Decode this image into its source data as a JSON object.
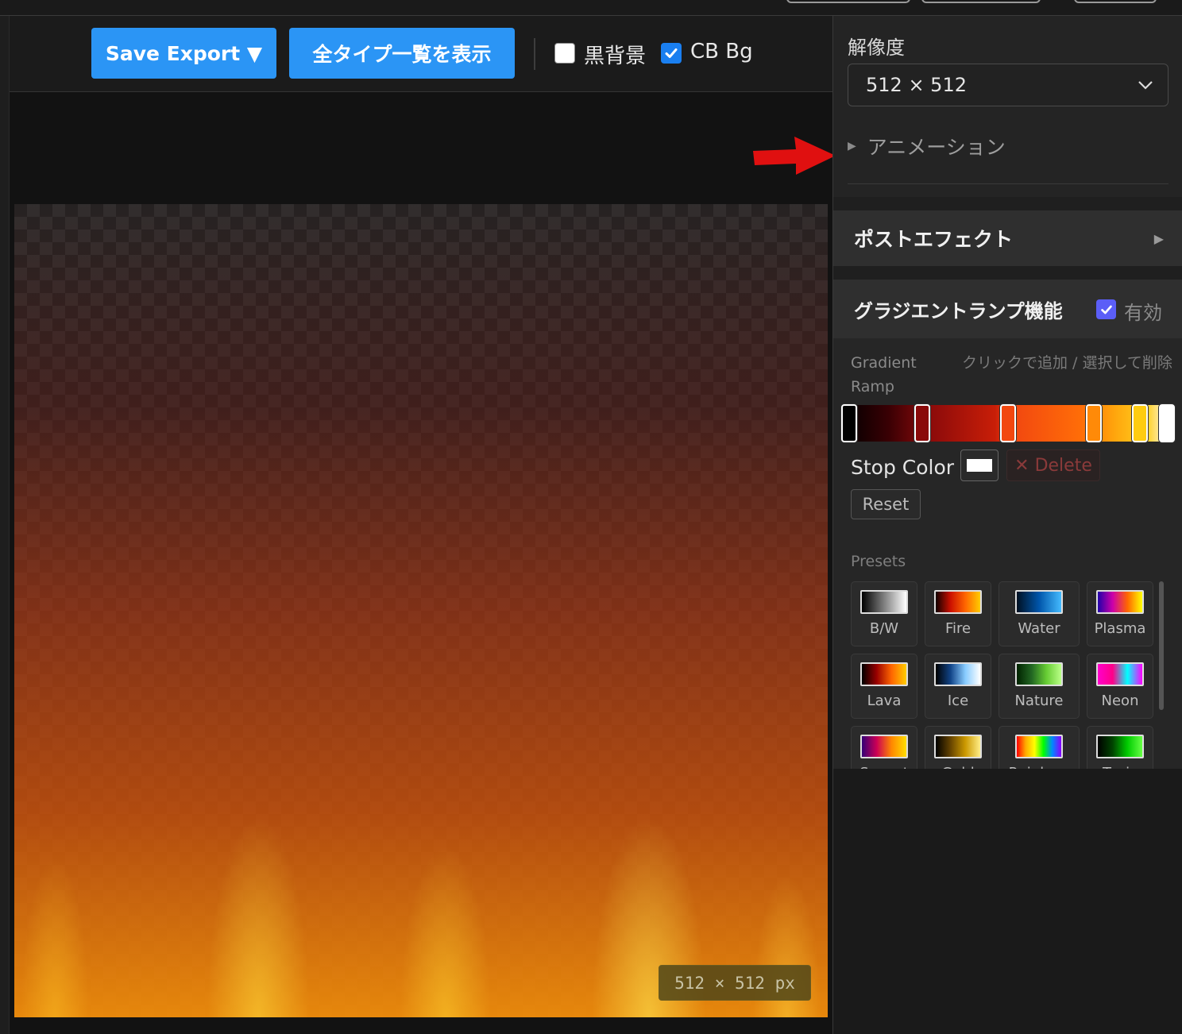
{
  "toolbar": {
    "save_export_label": "Save Export ▼",
    "show_all_types_label": "全タイプ一覧を表示",
    "black_bg_label": "黒背景",
    "black_bg_checked": false,
    "cb_bg_label": "CB Bg",
    "cb_bg_checked": true
  },
  "canvas": {
    "size_badge": "512 × 512 px"
  },
  "panel": {
    "resolution_label": "解像度",
    "resolution_value": "512 × 512",
    "animation_label": "アニメーション",
    "post_effect_label": "ポストエフェクト",
    "gradient": {
      "title": "グラジエントランプ機能",
      "enabled_label": "有効",
      "enabled": true,
      "ramp_label": "Gradient Ramp",
      "hint": "クリックで追加 / 選択して削除",
      "stops": [
        {
          "position": 0.0,
          "color": "#000000"
        },
        {
          "position": 0.24,
          "color": "#8a0a0a"
        },
        {
          "position": 0.5,
          "color": "#f24810"
        },
        {
          "position": 0.76,
          "color": "#ff8a08"
        },
        {
          "position": 0.9,
          "color": "#ffcc10"
        },
        {
          "position": 1.0,
          "color": "#ffffff"
        }
      ],
      "stop_color_label": "Stop Color",
      "stop_color_value": "#ffffff",
      "delete_label": "✕ Delete",
      "reset_label": "Reset",
      "presets_label": "Presets",
      "presets": [
        {
          "name": "B/W",
          "gradient": "linear-gradient(to right,#000,#fff)"
        },
        {
          "name": "Fire",
          "gradient": "linear-gradient(to right,#100,#c10,#f60,#fc0)"
        },
        {
          "name": "Water",
          "gradient": "linear-gradient(to right,#012,#05a,#4bf)"
        },
        {
          "name": "Plasma",
          "gradient": "linear-gradient(to right,#20a,#c0a,#f60,#ff0)"
        },
        {
          "name": "Lava",
          "gradient": "linear-gradient(to right,#000,#900,#f60,#fc0)"
        },
        {
          "name": "Ice",
          "gradient": "linear-gradient(to right,#000,#148,#8cf,#fff)"
        },
        {
          "name": "Nature",
          "gradient": "linear-gradient(to right,#020,#262,#6c3,#bf8)"
        },
        {
          "name": "Neon",
          "gradient": "linear-gradient(to right,#f0c,#f08,#0ff,#f0f)"
        },
        {
          "name": "Sunset",
          "gradient": "linear-gradient(to right,#307,#c05,#f80,#fd0)"
        },
        {
          "name": "Gold",
          "gradient": "linear-gradient(to right,#000,#640,#c90,#fe8)"
        },
        {
          "name": "Rainbow",
          "gradient": "linear-gradient(to right,#f00,#fa0,#ff0,#0f0,#08f,#80f)"
        },
        {
          "name": "Toxic",
          "gradient": "linear-gradient(to right,#000,#040,#0c0,#6f4)"
        }
      ]
    }
  },
  "colors": {
    "accent_blue": "#2b95f5",
    "checkbox_blue": "#1a7ff0",
    "enabled_purple": "#5b5ef7",
    "annotation_arrow": "#e01010"
  }
}
